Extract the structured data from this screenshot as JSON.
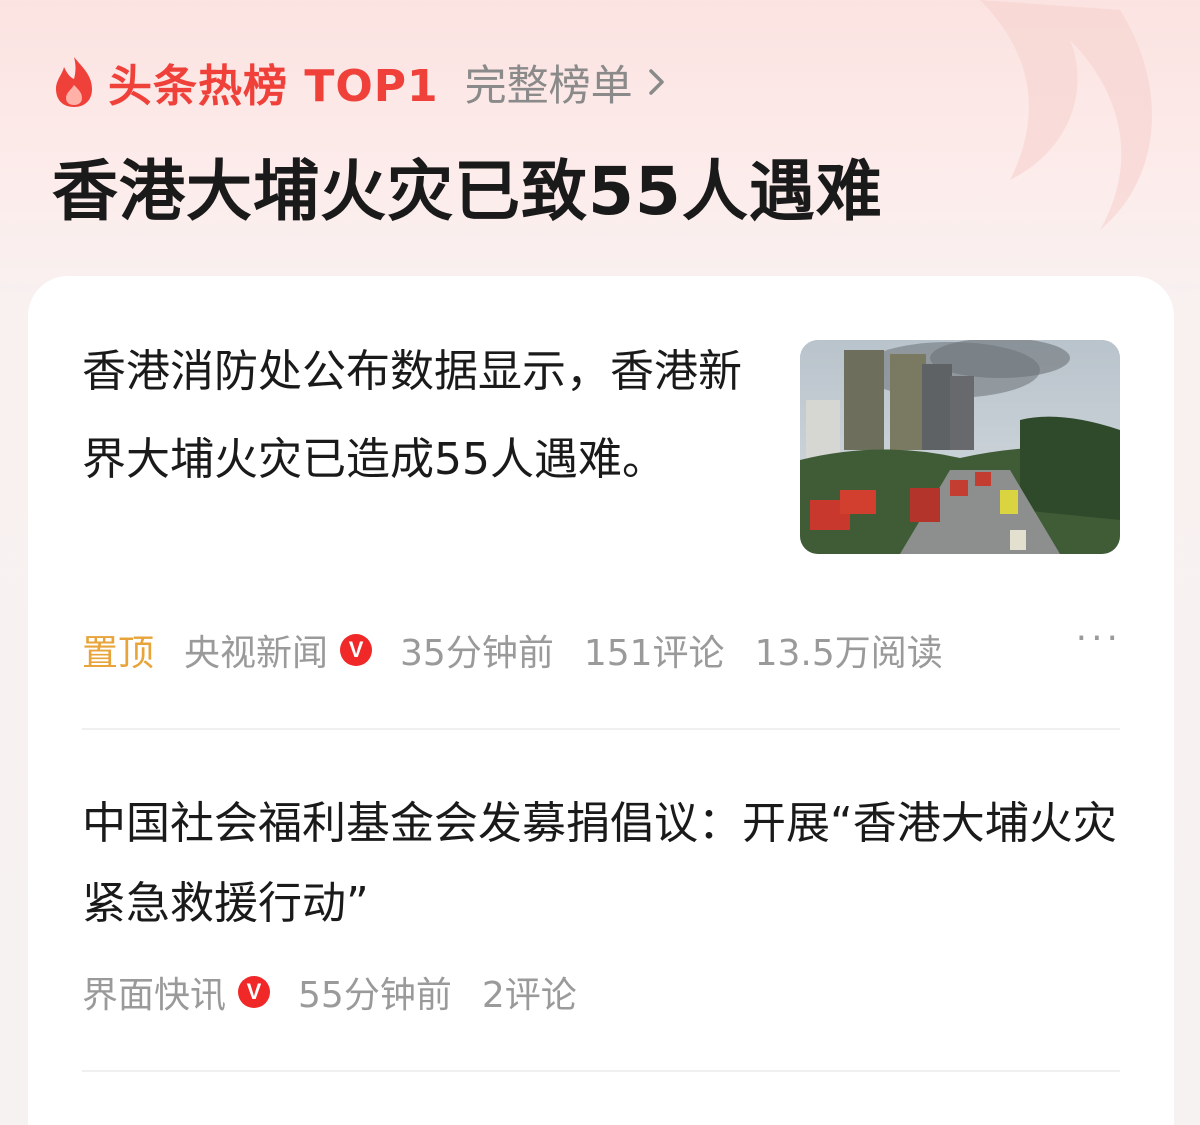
{
  "header": {
    "brand": "头条热榜 TOP1",
    "full_list": "完整榜单",
    "headline": "香港大埔火灾已致55人遇难"
  },
  "items": [
    {
      "title": "香港消防处公布数据显示，香港新界大埔火灾已造成55人遇难。",
      "pinned_label": "置顶",
      "source": "央视新闻",
      "verified_badge": "V",
      "time": "35分钟前",
      "comments": "151评论",
      "reads": "13.5万阅读",
      "more": "···",
      "thumbnail": "fire-scene-photo"
    },
    {
      "title": "中国社会福利基金会发募捐倡议：开展“香港大埔火灾紧急救援行动”",
      "source": "界面快讯",
      "verified_badge": "V",
      "time": "55分钟前",
      "comments": "2评论"
    }
  ],
  "colors": {
    "brand_red": "#f0403a",
    "pin_orange": "#e8a43a",
    "meta_gray": "#9a9a9a"
  }
}
